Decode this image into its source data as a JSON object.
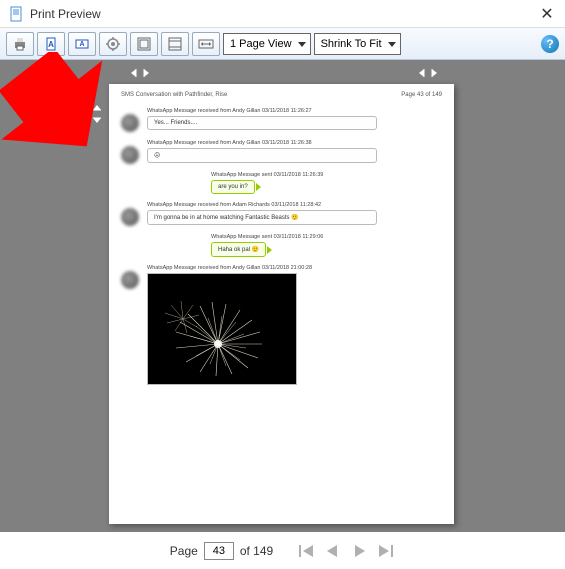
{
  "window": {
    "title": "Print Preview"
  },
  "toolbar": {
    "page_view": "1 Page View",
    "zoom": "Shrink To Fit"
  },
  "doc": {
    "header_left": "SMS Conversation with Pathfinder, Rise",
    "header_right": "Page 43 of 149",
    "messages": [
      {
        "dir": "recv",
        "meta": "WhatsApp Message received from Andy Gillan 03/11/2018 11:26:27",
        "text": "Yes... Friends...."
      },
      {
        "dir": "recv",
        "meta": "WhatsApp Message received from Andy Gillan 03/11/2018 11:26:38",
        "text": "☹"
      },
      {
        "dir": "sent",
        "meta": "WhatsApp Message sent 03/11/2018 11:26:39",
        "text": "are you in?"
      },
      {
        "dir": "recv",
        "meta": "WhatsApp Message received from Adam Richards 03/11/2018 11:28:42",
        "text": "I'm gonna be in at home watching Fantastic Beasts 🙂"
      },
      {
        "dir": "sent",
        "meta": "WhatsApp Message sent 03/11/2018 11:29:06",
        "text": "Haha ok pal 🙂"
      },
      {
        "dir": "recv",
        "meta": "WhatsApp Message received from Andy Gillan 03/11/2018 21:00:28",
        "text": "",
        "img": true
      }
    ]
  },
  "pager": {
    "label_page": "Page",
    "current": "43",
    "label_of": "of 149"
  }
}
